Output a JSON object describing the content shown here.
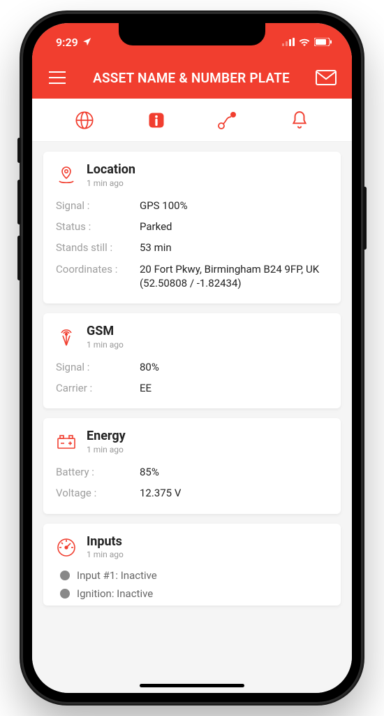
{
  "status_bar": {
    "time": "9:29"
  },
  "header": {
    "title": "ASSET NAME & NUMBER PLATE"
  },
  "cards": {
    "location": {
      "title": "Location",
      "subtitle": "1 min ago",
      "signal_label": "Signal :",
      "signal_value": "GPS 100%",
      "status_label": "Status :",
      "status_value": "Parked",
      "stands_label": "Stands still :",
      "stands_value": "53 min",
      "coords_label": "Coordinates :",
      "coords_value": "20 Fort Pkwy, Birmingham B24 9FP, UK (52.50808 / -1.82434)"
    },
    "gsm": {
      "title": "GSM",
      "subtitle": "1 min ago",
      "signal_label": "Signal :",
      "signal_value": "80%",
      "carrier_label": "Carrier :",
      "carrier_value": "EE"
    },
    "energy": {
      "title": "Energy",
      "subtitle": "1 min ago",
      "battery_label": "Battery :",
      "battery_value": "85%",
      "voltage_label": "Voltage :",
      "voltage_value": "12.375 V"
    },
    "inputs": {
      "title": "Inputs",
      "subtitle": "1 min ago",
      "row1": "Input #1: Inactive",
      "row2": "Ignition: Inactive"
    }
  }
}
